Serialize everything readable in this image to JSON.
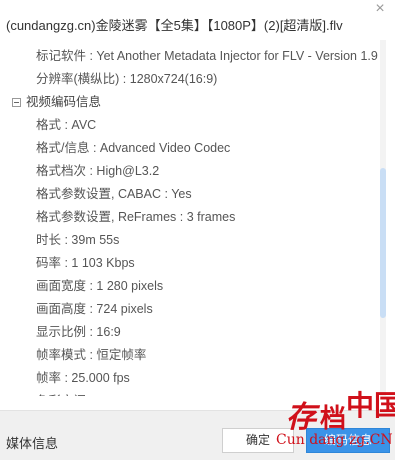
{
  "window": {
    "title": "(cundangzg.cn)金陵迷雾【全5集】【1080P】(2)[超清版].flv",
    "close_glyph": "×"
  },
  "rows": [
    {
      "text": "标记软件 : Yet Another Metadata Injector for FLV - Version 1.9",
      "level": 2
    },
    {
      "text": "分辨率(横纵比) : 1280x724(16:9)",
      "level": 2
    },
    {
      "text": "视频编码信息",
      "level": 1
    },
    {
      "text": "格式 : AVC",
      "level": 2
    },
    {
      "text": "格式/信息 : Advanced Video Codec",
      "level": 2
    },
    {
      "text": "格式档次 : High@L3.2",
      "level": 2
    },
    {
      "text": "格式参数设置, CABAC : Yes",
      "level": 2
    },
    {
      "text": "格式参数设置, ReFrames : 3 frames",
      "level": 2
    },
    {
      "text": "时长 : 39m 55s",
      "level": 2
    },
    {
      "text": "码率 : 1 103 Kbps",
      "level": 2
    },
    {
      "text": "画面宽度 : 1 280 pixels",
      "level": 2
    },
    {
      "text": "画面高度 : 724 pixels",
      "level": 2
    },
    {
      "text": "显示比例 : 16:9",
      "level": 2
    },
    {
      "text": "帧率模式 : 恒定帧率",
      "level": 2
    },
    {
      "text": "帧率 : 25.000 fps",
      "level": 2
    },
    {
      "text": "色彩空间 : YUV",
      "level": 2
    }
  ],
  "scroll_position_fraction": 0.5,
  "footer": {
    "label": "媒体信息",
    "ok_button": "确定",
    "edit_button": "编码信息"
  },
  "watermark": {
    "chars": [
      "存",
      "档",
      "中国"
    ],
    "url": "Cun dang zg.CN"
  },
  "colors": {
    "accent": "#3a93e8",
    "watermark_red": "#d0101a",
    "scroll_thumb": "#c9def5"
  }
}
